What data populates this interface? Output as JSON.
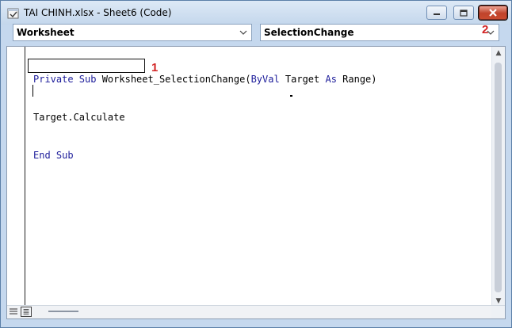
{
  "window": {
    "title": "TAI CHINH.xlsx - Sheet6 (Code)",
    "icons": {
      "app": "vba-module-icon",
      "minimize": "minimize-icon",
      "maximize": "maximize-icon",
      "close": "close-icon"
    }
  },
  "toolbar": {
    "object_combo": {
      "value": "Worksheet"
    },
    "procedure_combo": {
      "value": "SelectionChange"
    }
  },
  "annotations": {
    "marker_1": "1",
    "marker_2": "2"
  },
  "code": {
    "line1": {
      "kw1": "Private Sub",
      "rest1": " Worksheet_SelectionChange(",
      "kw2": "ByVal",
      "rest2": " Target ",
      "kw3": "As",
      "rest3": " Range)"
    },
    "line2": {
      "text": "Target.Calculate"
    },
    "line3": {
      "kw": "End Sub"
    }
  },
  "colors": {
    "keyword": "#1c1c9a",
    "marker": "#d32424",
    "close_button": "#c0432b"
  }
}
